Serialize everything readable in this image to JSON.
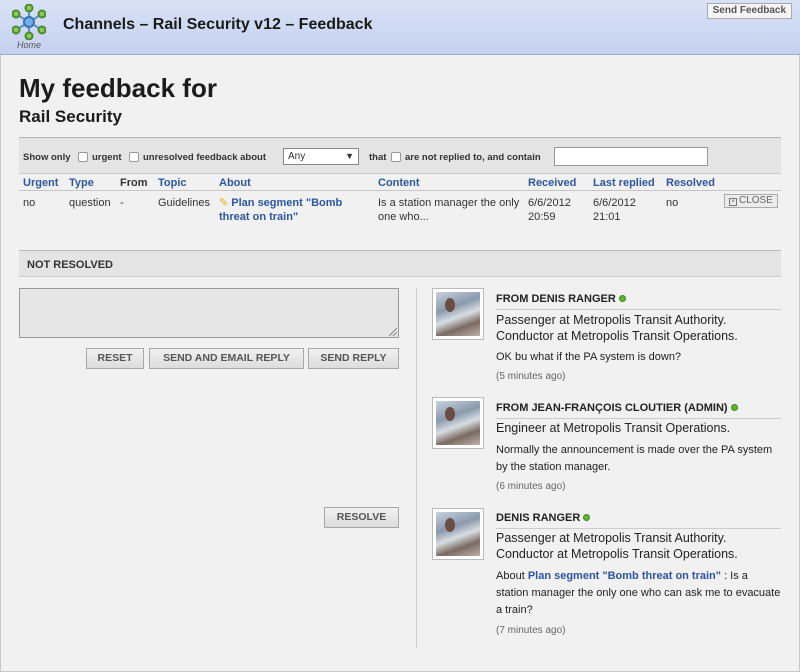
{
  "header": {
    "logo_label": "Home",
    "title": "Channels – Rail Security v12 – Feedback",
    "send_feedback": "Send Feedback"
  },
  "page": {
    "title": "My feedback for",
    "subtitle": "Rail Security"
  },
  "filter": {
    "show_only": "Show only",
    "urgent": "urgent",
    "unresolved": "unresolved feedback about",
    "select_value": "Any",
    "that": "that",
    "not_replied": "are not replied to, and contain",
    "search_value": ""
  },
  "table": {
    "headers": [
      "Urgent",
      "Type",
      "From",
      "Topic",
      "About",
      "Content",
      "Received",
      "Last replied",
      "Resolved"
    ],
    "row": {
      "urgent": "no",
      "type": "question",
      "from": "-",
      "topic": "Guidelines",
      "about": "Plan segment \"Bomb threat on train\"",
      "content": "Is a station manager the only one who...",
      "received": "6/6/2012 20:59",
      "last_replied": "6/6/2012 21:01",
      "resolved": "no",
      "close": "CLOSE"
    }
  },
  "section": {
    "title": "NOT RESOLVED"
  },
  "reply": {
    "text": "",
    "reset": "RESET",
    "send_email": "SEND AND EMAIL REPLY",
    "send": "SEND REPLY",
    "resolve": "RESOLVE"
  },
  "feed": [
    {
      "name": "FROM DENIS RANGER",
      "role": "Passenger at Metropolis Transit Authority. Conductor at Metropolis Transit Operations.",
      "message": "OK bu what if the PA system is down?",
      "time": "(5 minutes ago)"
    },
    {
      "name": "FROM JEAN-FRANÇOIS CLOUTIER (ADMIN)",
      "role": "Engineer at Metropolis Transit Operations.",
      "message": "Normally the announcement is made over the PA system by the station manager.",
      "time": "(6 minutes ago)"
    },
    {
      "name": "DENIS RANGER",
      "role": "Passenger at Metropolis Transit Authority. Conductor at Metropolis Transit Operations.",
      "message_prefix": "About",
      "message_link": "Plan segment \"Bomb threat on train\"",
      "message_suffix": ": Is a station manager the only one who can ask me to evacuate a train?",
      "time": "(7 minutes ago)"
    }
  ],
  "colors": {
    "link": "#2c55a4",
    "online": "#5cb82c",
    "header_bg": "#c4d1ef"
  }
}
